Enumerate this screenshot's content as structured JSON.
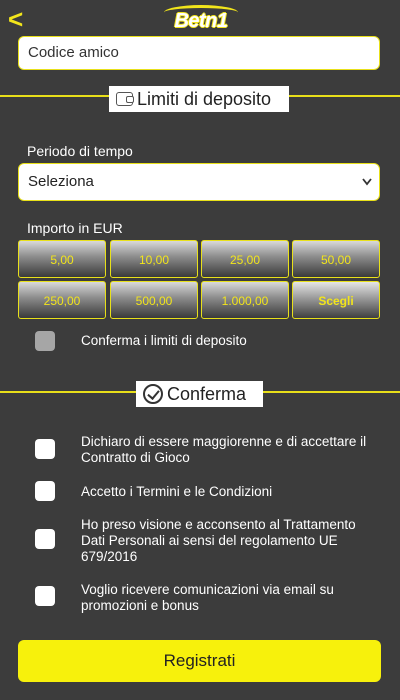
{
  "header": {
    "back_glyph": "<",
    "logo_text": "Betn1"
  },
  "form": {
    "codice_amico_placeholder": "Codice amico",
    "deposit_section_title": "Limiti di deposito",
    "periodo_label": "Periodo di tempo",
    "periodo_value": "Seleziona",
    "importo_label": "Importo in EUR",
    "amounts": [
      "5,00",
      "10,00",
      "25,00",
      "50,00",
      "250,00",
      "500,00",
      "1.000,00",
      "Scegli"
    ],
    "confirm_limits_label": "Conferma i limiti di deposito",
    "confirm_section_title": "Conferma",
    "checkboxes": [
      "Dichiaro di essere maggiorenne e di accettare il Contratto di Gioco",
      "Accetto i Termini e le Condizioni",
      "Ho preso visione e acconsento al Trattamento Dati Personali ai sensi del regolamento UE 679/2016",
      "Voglio ricevere comunicazioni via email su promozioni e bonus"
    ],
    "submit_label": "Registrati"
  },
  "colors": {
    "background": "#3c3c3c",
    "accent": "#f2e51b",
    "button": "#f7f10c"
  },
  "icons": {
    "back": "chevron-left-icon",
    "deposit": "wallet-icon",
    "confirm": "check-circle-icon",
    "select": "chevron-down-icon"
  }
}
